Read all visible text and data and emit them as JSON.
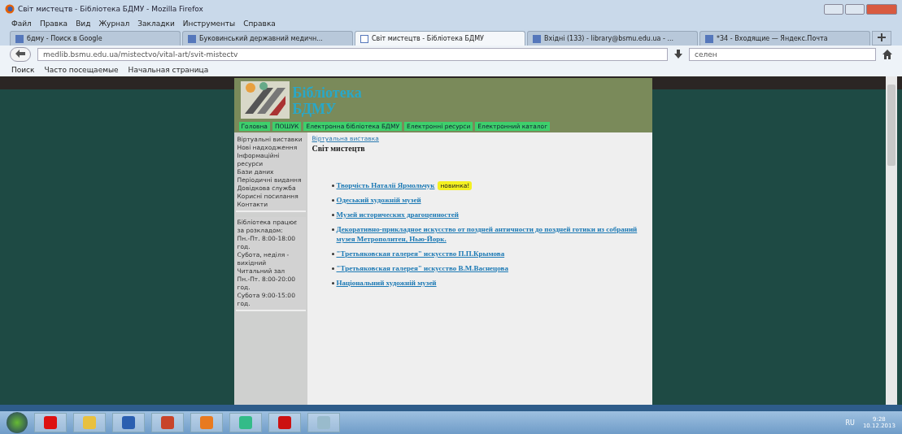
{
  "window": {
    "title": "Світ мистецтв - Бібліотека БДМУ - Mozilla Firefox"
  },
  "menu": [
    "Файл",
    "Правка",
    "Вид",
    "Журнал",
    "Закладки",
    "Инструменты",
    "Справка"
  ],
  "tabs": [
    {
      "label": "бдму - Поиск в Google",
      "selected": false
    },
    {
      "label": "Буковинський державний медичн...",
      "selected": false
    },
    {
      "label": "Світ мистецтв - Бібліотека БДМУ",
      "selected": true
    },
    {
      "label": "Вхідні (133) - library@bsmu.edu.ua - ...",
      "selected": false
    },
    {
      "label": "*34 - Входящие — Яндекс.Почта",
      "selected": false
    }
  ],
  "address": {
    "value": "medlib.bsmu.edu.ua/mistectvo/vital-art/svit-mistectv"
  },
  "search": {
    "value": "селен"
  },
  "bookmarks": [
    "Поиск",
    "Часто посещаемые",
    "Начальная страница"
  ],
  "site": {
    "title_lines": [
      "Бібліотека",
      "БДМУ"
    ],
    "nav": [
      "Головна",
      "ПОШУК",
      "Електронна бібліотека БДМУ",
      "Електронні ресурси",
      "Електронний каталог"
    ],
    "sidebar_blocks": [
      [
        "Віртуальні виставки",
        "Нові надходження",
        "Інформаційні ресурси",
        "Бази даних",
        "Періодичні видання",
        "Довідкова служба",
        "Корисні посилання",
        "Контакти"
      ],
      [
        "Бібліотека працює за розкладом:",
        "Пн.-Пт. 8:00-18:00 год.",
        "Субота, неділя - вихідний",
        "Читальний зал",
        "Пн.-Пт. 8:00-20:00 год.",
        "Субота 9:00-15:00 год."
      ]
    ],
    "breadcrumb": "Віртуальна виставка",
    "heading": "Світ мистецтв",
    "links": [
      {
        "text": "Творчість Наталії Ярмольчук",
        "badge": "новинка!"
      },
      {
        "text": "Одеський художній музей"
      },
      {
        "text": "Музей исторических драгоценностей"
      },
      {
        "text": "Декоративно-прикладное искусство от поздней античности до поздней готики из собраний музея Метрополитен, Нью-Йорк."
      },
      {
        "text": "\"Третьяковская галерея\" искусство П.П.Крымова"
      },
      {
        "text": "\"Третьяковская галерея\" искусство В.М.Васнецова"
      },
      {
        "text": "Національний художній музей"
      }
    ]
  },
  "taskbar": {
    "language": "RU",
    "time": "9:28",
    "date": "10.12.2013"
  }
}
